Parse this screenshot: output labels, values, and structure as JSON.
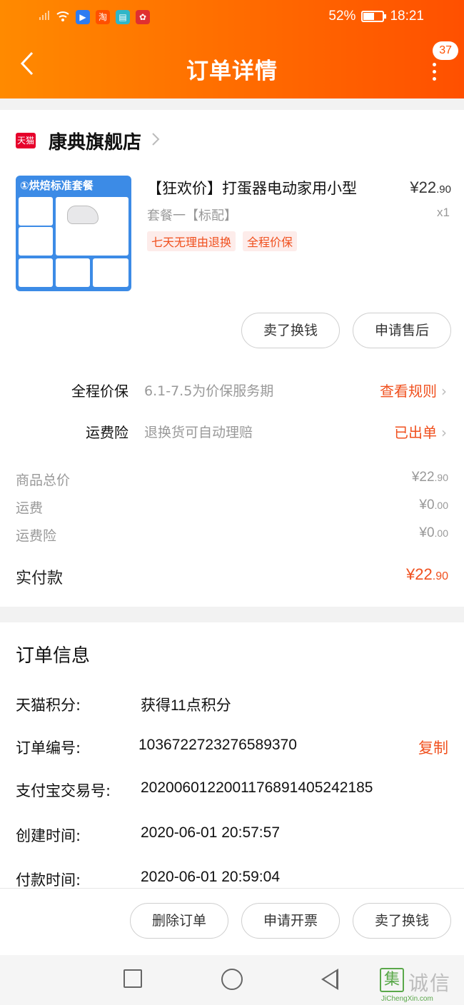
{
  "status_bar": {
    "battery": "52%",
    "battery_level": 0.52,
    "time": "18:21"
  },
  "header": {
    "title": "订单详情",
    "badge_count": "37"
  },
  "shop": {
    "logo_text": "天猫",
    "name": "康典旗舰店"
  },
  "product": {
    "image_caption": "①烘焙标准套餐",
    "title": "【狂欢价】打蛋器电动家用小型",
    "price_int": "¥22",
    "price_dec": ".90",
    "sku": "套餐一【标配】",
    "qty": "x1",
    "tags": [
      "七天无理由退换",
      "全程价保"
    ]
  },
  "product_actions": {
    "sell_label": "卖了换钱",
    "after_sale_label": "申请售后"
  },
  "services": [
    {
      "label": "全程价保",
      "desc": "6.1-7.5为价保服务期",
      "link": "查看规则"
    },
    {
      "label": "运费险",
      "desc": "退换货可自动理赔",
      "link": "已出单"
    }
  ],
  "fees": [
    {
      "label": "商品总价",
      "int": "¥22",
      "dec": ".90"
    },
    {
      "label": "运费",
      "int": "¥0",
      "dec": ".00"
    },
    {
      "label": "运费险",
      "int": "¥0",
      "dec": ".00"
    }
  ],
  "paid": {
    "label": "实付款",
    "int": "¥22",
    "dec": ".90"
  },
  "order_info": {
    "title": "订单信息",
    "rows": [
      {
        "label": "天猫积分:",
        "value": "获得11点积分"
      },
      {
        "label": "订单编号:",
        "value": "1036722723276589370",
        "action": "复制"
      },
      {
        "label": "支付宝交易号:",
        "value": "2020060122001176891405242185"
      },
      {
        "label": "创建时间:",
        "value": "2020-06-01 20:57:57"
      },
      {
        "label": "付款时间:",
        "value": "2020-06-01 20:59:04"
      }
    ]
  },
  "bottom_actions": {
    "delete_label": "删除订单",
    "invoice_label": "申请开票",
    "sell_label": "卖了换钱"
  },
  "watermark": {
    "char": "集",
    "text": "诚信",
    "url": "JiChengXin.com"
  }
}
